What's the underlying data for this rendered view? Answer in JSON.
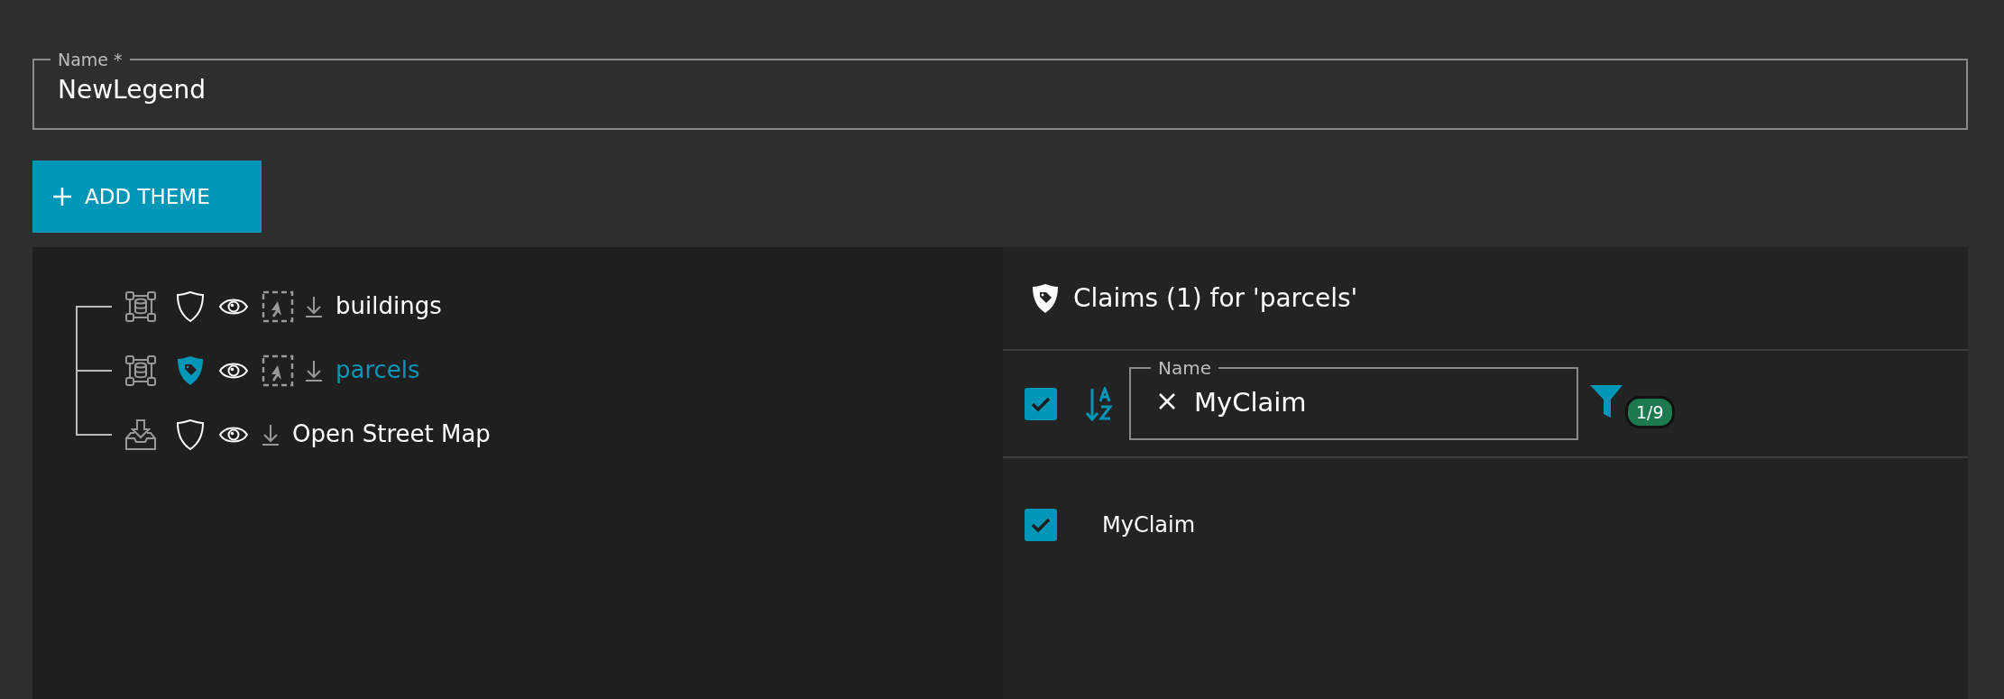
{
  "name_field": {
    "label": "Name *",
    "value": "NewLegend"
  },
  "add_button": {
    "label": "ADD THEME"
  },
  "tree": {
    "items": [
      {
        "label": "buildings",
        "kind": "dataset",
        "secured": false,
        "selectable": true,
        "selected": false
      },
      {
        "label": "parcels",
        "kind": "dataset",
        "secured": true,
        "selectable": true,
        "selected": true
      },
      {
        "label": "Open Street Map",
        "kind": "import",
        "secured": false,
        "selectable": false,
        "selected": false
      }
    ]
  },
  "claims_panel": {
    "title": "Claims (1) for 'parcels'",
    "select_all_checked": true,
    "filter_field": {
      "label": "Name",
      "value": "MyClaim"
    },
    "filter_count": "1/9",
    "claims": [
      {
        "name": "MyClaim",
        "checked": true
      }
    ]
  }
}
